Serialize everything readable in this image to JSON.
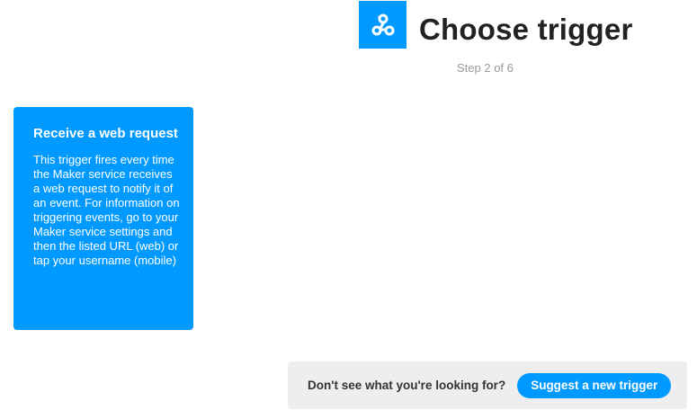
{
  "header": {
    "service_icon": "webhooks-icon",
    "title": "Choose trigger",
    "step": "Step 2 of 6"
  },
  "triggers": [
    {
      "title": "Receive a web request",
      "description": "This trigger fires every time the Maker service receives a web request to notify it of an event. For information on triggering events, go to your Maker service settings and then the listed URL (web) or tap your username (mobile)"
    }
  ],
  "footer": {
    "prompt": "Don't see what you're looking for?",
    "button_label": "Suggest a new trigger"
  },
  "colors": {
    "brand": "#0099ff",
    "title_text": "#222222",
    "muted_text": "#999999",
    "footer_bg": "#eeeeee"
  }
}
